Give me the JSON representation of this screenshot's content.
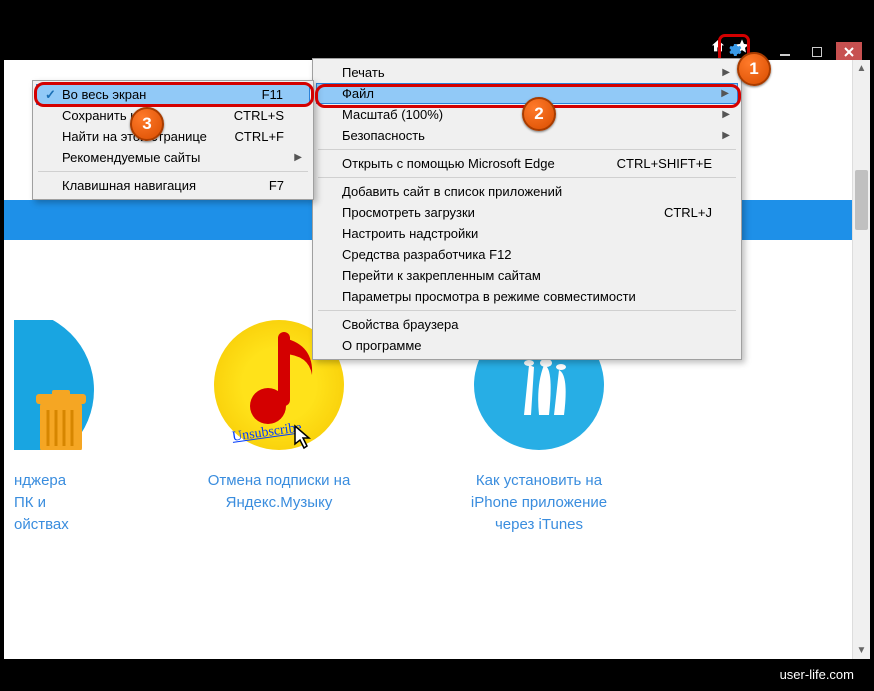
{
  "main_menu": {
    "print": "Печать",
    "file": "Файл",
    "zoom": "Масштаб (100%)",
    "safety": "Безопасность",
    "open_edge": "Открыть с помощью Microsoft Edge",
    "open_edge_key": "CTRL+SHIFT+E",
    "add_site": "Добавить сайт в список приложений",
    "downloads": "Просмотреть загрузки",
    "downloads_key": "CTRL+J",
    "addons": "Настроить надстройки",
    "f12": "Средства разработчика F12",
    "pinned": "Перейти к закрепленным сайтам",
    "compat": "Параметры просмотра в режиме совместимости",
    "props": "Свойства браузера",
    "about": "О программе"
  },
  "sub_menu": {
    "fullscreen": "Во весь экран",
    "fullscreen_key": "F11",
    "save_as": "Сохранить как...",
    "save_as_key": "CTRL+S",
    "find": "Найти на этой странице",
    "find_key": "CTRL+F",
    "suggested": "Рекомендуемые сайты",
    "keyboard": "Клавишная навигация",
    "keyboard_key": "F7"
  },
  "cards": {
    "c1_l1": "нджера",
    "c1_l2": "ПК и",
    "c1_l3": "ойствах",
    "c2_l1": "Отмена подписки на",
    "c2_l2": "Яндекс.Музыку",
    "c2_unsub": "Unsubscribe",
    "c3_l1": "Как установить на",
    "c3_l2": "iPhone приложение",
    "c3_l3": "через iTunes"
  },
  "badges": {
    "b1": "1",
    "b2": "2",
    "b3": "3"
  },
  "footer": "user-life.com"
}
